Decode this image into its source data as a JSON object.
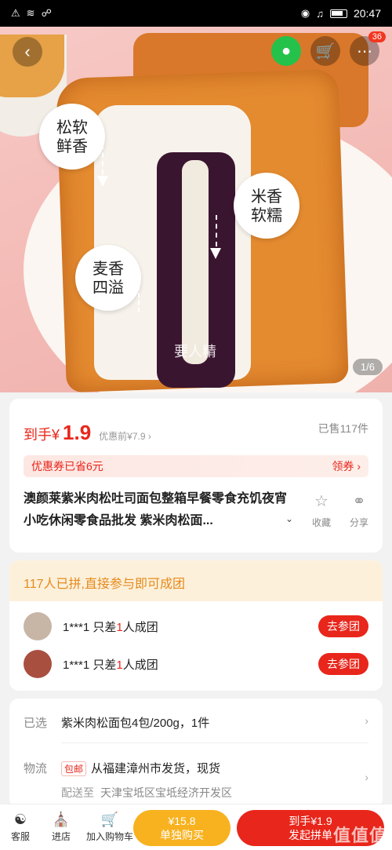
{
  "status_bar": {
    "time": "20:47"
  },
  "hero": {
    "bubbles": [
      {
        "line1": "松软",
        "line2": "鲜香"
      },
      {
        "line1": "米香",
        "line2": "软糯"
      },
      {
        "line1": "麦香",
        "line2": "四溢"
      }
    ],
    "image_watermark": "要人精",
    "image_counter": "1/6",
    "cart_badge": "36"
  },
  "price": {
    "prefix": "到手¥",
    "value": "1.9",
    "original": "优惠前¥7.9 ›",
    "sold": "已售117件",
    "coupon_text": "优惠券已省6元",
    "coupon_action": "领券 ›"
  },
  "product": {
    "title": "澳颜莱紫米肉松吐司面包整箱早餐零食充饥夜宵小吃休闲零食品批发 紫米肉松面...",
    "fav_label": "收藏",
    "share_label": "分享"
  },
  "group": {
    "header": "117人已拼,直接参与即可成团",
    "rows": [
      {
        "user": "1***1",
        "prefix": "只差",
        "count": "1",
        "suffix": "人成团",
        "button": "去参团"
      },
      {
        "user": "1***1",
        "prefix": "只差",
        "count": "1",
        "suffix": "人成团",
        "button": "去参团"
      }
    ]
  },
  "spec": {
    "selected_label": "已选",
    "selected_value": "紫米肉松面包4包/200g，1件",
    "shipping_label": "物流",
    "shipping_tag": "包邮",
    "shipping_value": "从福建漳州市发货，现货",
    "deliver_to_label": "配送至",
    "deliver_to_value": "天津宝坻区宝坻经济开发区"
  },
  "bottom_bar": {
    "service": "客服",
    "store": "进店",
    "add_cart": "加入购物车",
    "solo_price": "¥15.8",
    "solo_label": "单独购买",
    "group_price": "到手¥1.9",
    "group_label": "发起拼单",
    "site_mark": "值值值"
  }
}
